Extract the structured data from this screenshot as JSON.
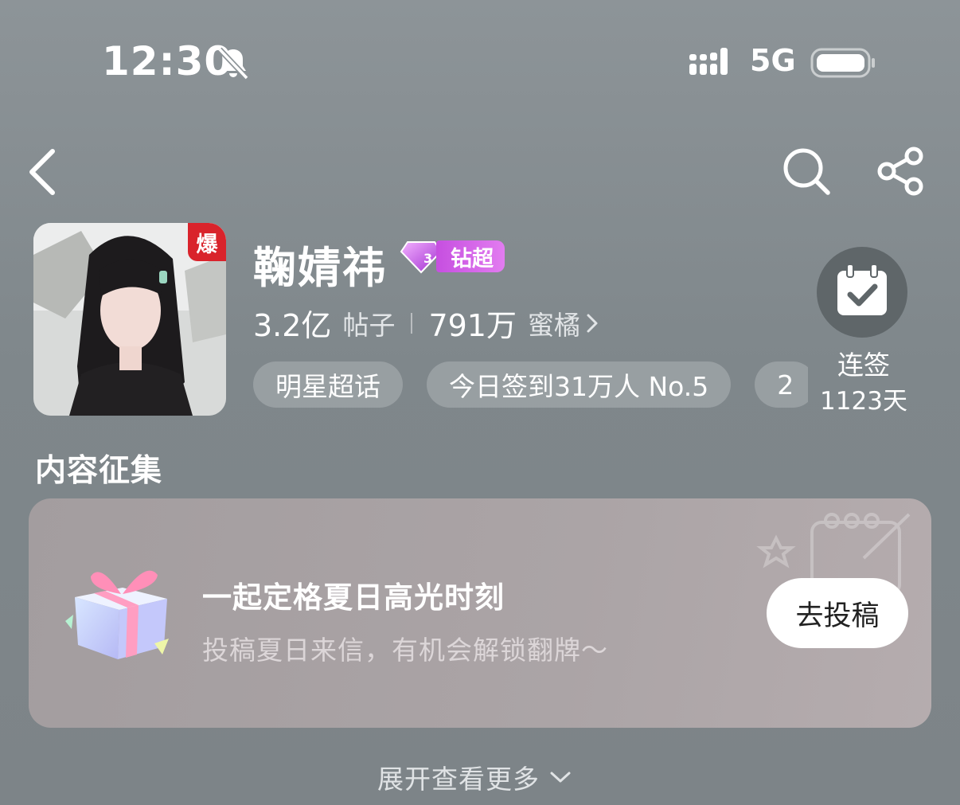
{
  "status_bar": {
    "time": "12:30",
    "network": "5G"
  },
  "header": {
    "name": "鞠婧祎",
    "avatar_badge": "爆",
    "level_tag": "钻超",
    "posts_count": "3.2亿",
    "posts_label": "帖子",
    "fans_count": "791万",
    "fans_label": "蜜橘",
    "chips": [
      "明星超话",
      "今日签到31万人 No.5",
      "2"
    ]
  },
  "checkin": {
    "label": "连签",
    "days": "1123天"
  },
  "content": {
    "section_title": "内容征集",
    "card_title": "一起定格夏日高光时刻",
    "card_subtitle": "投稿夏日来信，有机会解锁翻牌～",
    "card_button": "去投稿"
  },
  "footer": {
    "expand_label": "展开查看更多"
  },
  "colors": {
    "accent_purple": "#c64fe0",
    "hot_red": "#d9232b",
    "background": "#8d9498"
  },
  "icons": [
    "bell-muted-icon",
    "signal-icon",
    "battery-icon",
    "back-icon",
    "search-icon",
    "share-icon",
    "calendar-check-icon",
    "diamond-icon",
    "gift-icon",
    "chevron-right-icon",
    "chevron-down-icon"
  ]
}
